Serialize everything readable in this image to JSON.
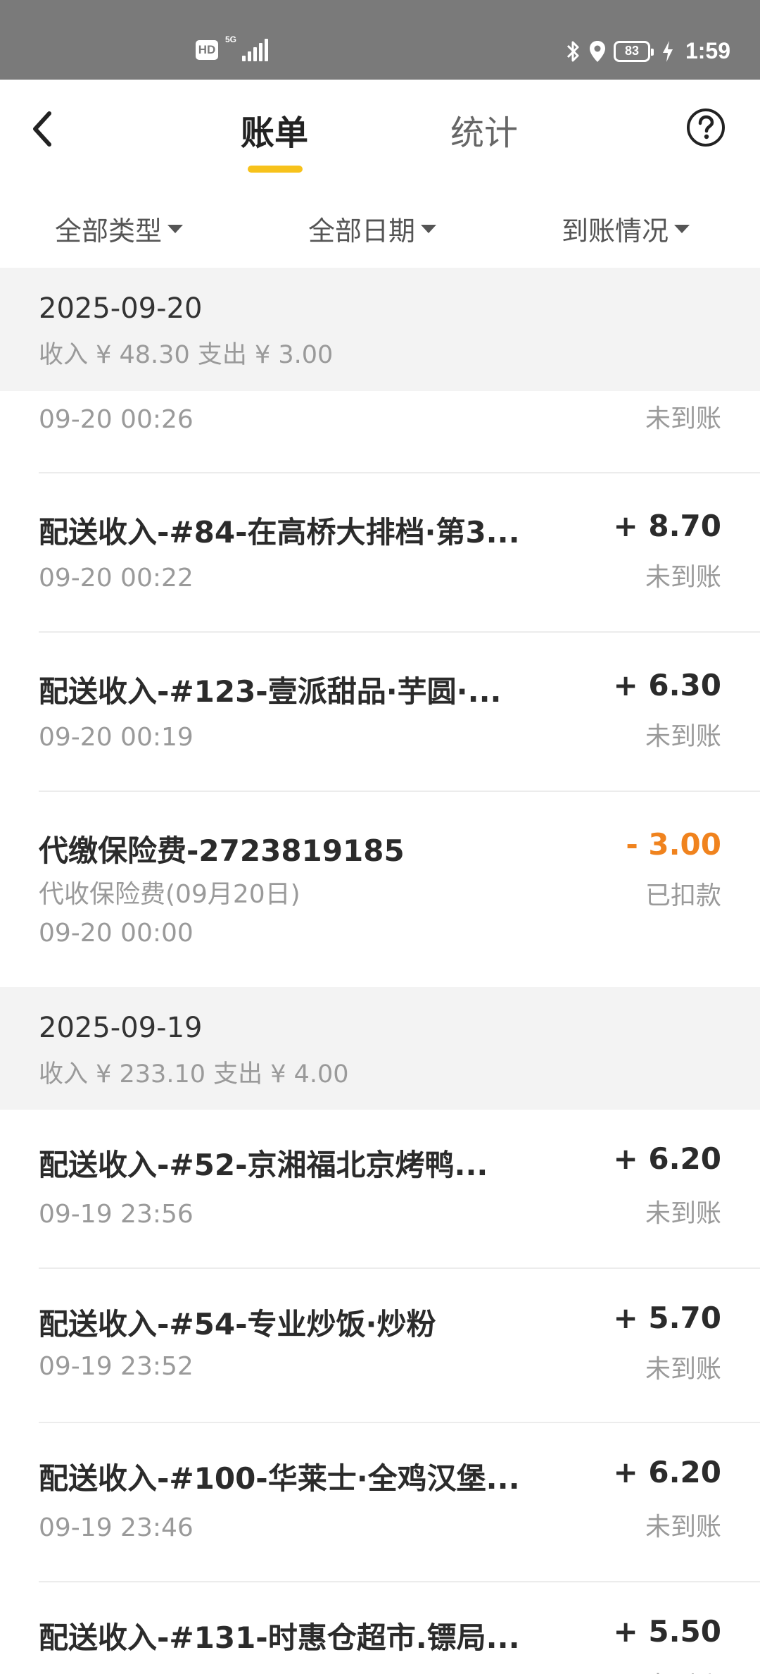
{
  "status_bar": {
    "hd": "HD",
    "network": "5G",
    "battery": "83",
    "time": "1:59",
    "icons": [
      "hd-icon",
      "signal-icon",
      "bluetooth-icon",
      "location-icon",
      "battery-icon",
      "charging-icon"
    ]
  },
  "header": {
    "tabs": [
      {
        "label": "账单",
        "active": true
      },
      {
        "label": "统计",
        "active": false
      }
    ],
    "accent": "#f7c21b",
    "icons": [
      "back-arrow-icon",
      "help-circle-icon"
    ]
  },
  "filters": [
    {
      "label": "全部类型"
    },
    {
      "label": "全部日期"
    },
    {
      "label": "到账情况"
    }
  ],
  "sections": [
    {
      "date": "2025-09-20",
      "summary": "收入 ¥ 48.30 支出 ¥ 3.00",
      "items": [
        {
          "title": "",
          "subtitle": "",
          "time": "09-20 00:26",
          "amount": "",
          "status": "未到账"
        },
        {
          "title": "配送收入-#84-在高桥大排档·第3...",
          "subtitle": "",
          "time": "09-20 00:22",
          "amount": "+ 8.70",
          "status": "未到账"
        },
        {
          "title": "配送收入-#123-壹派甜品·芋圆·...",
          "subtitle": "",
          "time": "09-20 00:19",
          "amount": "+ 6.30",
          "status": "未到账"
        },
        {
          "title": "代缴保险费-2723819185",
          "subtitle": "代收保险费(09月20日)",
          "time": "09-20 00:00",
          "amount": "- 3.00",
          "status": "已扣款",
          "negative": true
        }
      ]
    },
    {
      "date": "2025-09-19",
      "summary": "收入 ¥ 233.10 支出 ¥ 4.00",
      "items": [
        {
          "title": "配送收入-#52-京湘福北京烤鸭...",
          "subtitle": "",
          "time": "09-19 23:56",
          "amount": "+ 6.20",
          "status": "未到账"
        },
        {
          "title": "配送收入-#54-专业炒饭·炒粉",
          "subtitle": "",
          "time": "09-19 23:52",
          "amount": "+ 5.70",
          "status": "未到账"
        },
        {
          "title": "配送收入-#100-华莱士·全鸡汉堡...",
          "subtitle": "",
          "time": "09-19 23:46",
          "amount": "+ 6.20",
          "status": "未到账"
        },
        {
          "title": "配送收入-#131-时惠仓超市.镖局...",
          "subtitle": "",
          "time": "",
          "amount": "+ 5.50",
          "status": "未到账"
        }
      ]
    }
  ],
  "colors": {
    "negative_amount": "#f0831e",
    "section_background": "#f3f3f3",
    "status_bar": "#7a7a7a"
  }
}
